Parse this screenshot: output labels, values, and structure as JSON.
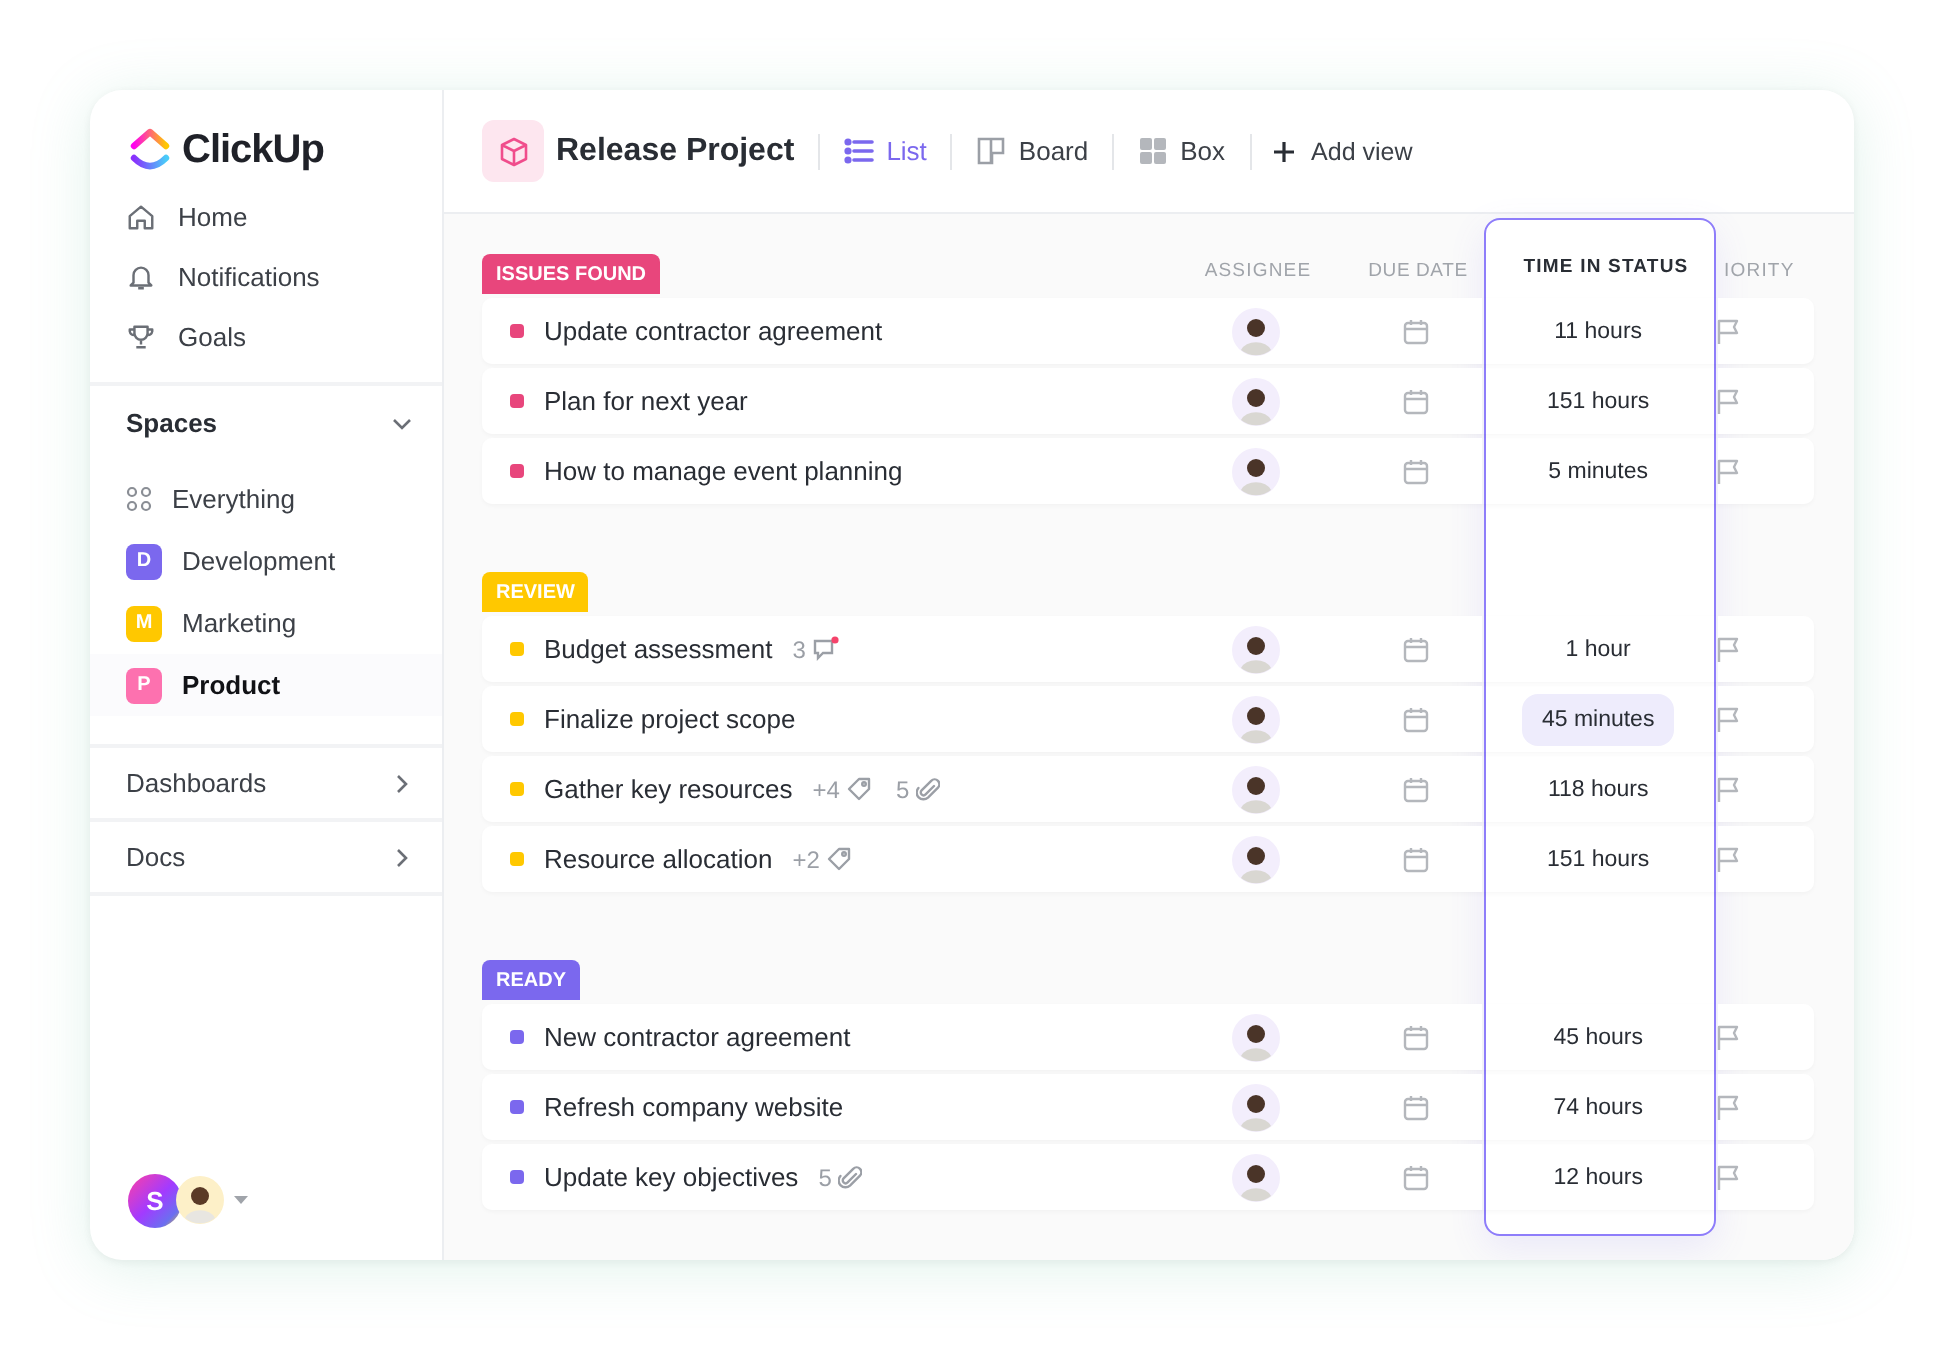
{
  "logo": {
    "text": "ClickUp"
  },
  "nav": [
    {
      "label": "Home"
    },
    {
      "label": "Notifications"
    },
    {
      "label": "Goals"
    }
  ],
  "spaces": {
    "title": "Spaces",
    "expanded": true,
    "items": [
      {
        "kind": "all",
        "label": "Everything",
        "selected": false
      },
      {
        "kind": "space",
        "initial": "D",
        "label": "Development",
        "color": "#7b68ee",
        "selected": false
      },
      {
        "kind": "space",
        "initial": "M",
        "label": "Marketing",
        "color": "#ffc800",
        "selected": false
      },
      {
        "kind": "space",
        "initial": "P",
        "label": "Product",
        "color": "#fd71af",
        "selected": true
      }
    ]
  },
  "sections": [
    {
      "label": "Dashboards"
    },
    {
      "label": "Docs"
    }
  ],
  "user": {
    "initial": "S"
  },
  "project": {
    "title": "Release Project"
  },
  "views": [
    {
      "label": "List",
      "selected": true
    },
    {
      "label": "Board",
      "selected": false
    },
    {
      "label": "Box",
      "selected": false
    }
  ],
  "add_view": "Add view",
  "columns": {
    "assignee": "ASSIGNEE",
    "due_date": "DUE DATE",
    "time_in_status": "TIME IN STATUS",
    "priority": "IORITY"
  },
  "groups": [
    {
      "status": "ISSUES FOUND",
      "color": "#e8467c",
      "tasks": [
        {
          "title": "Update contractor agreement",
          "time_in_status": "11 hours",
          "highlighted": false
        },
        {
          "title": "Plan for next year",
          "time_in_status": "151 hours",
          "highlighted": false
        },
        {
          "title": "How to manage event planning",
          "time_in_status": "5 minutes",
          "highlighted": false
        }
      ]
    },
    {
      "status": "REVIEW",
      "color": "#ffc800",
      "tasks": [
        {
          "title": "Budget assessment",
          "extras": [
            {
              "kind": "comments",
              "count": "3"
            }
          ],
          "time_in_status": "1 hour",
          "highlighted": false
        },
        {
          "title": "Finalize project scope",
          "time_in_status": "45 minutes",
          "highlighted": true
        },
        {
          "title": "Gather key resources",
          "extras": [
            {
              "kind": "tags",
              "count": "+4"
            },
            {
              "kind": "attachments",
              "count": "5"
            }
          ],
          "time_in_status": "118 hours",
          "highlighted": false
        },
        {
          "title": "Resource allocation",
          "extras": [
            {
              "kind": "tags",
              "count": "+2"
            }
          ],
          "time_in_status": "151 hours",
          "highlighted": false
        }
      ]
    },
    {
      "status": "READY",
      "color": "#7b68ee",
      "tasks": [
        {
          "title": "New contractor agreement",
          "time_in_status": "45 hours",
          "highlighted": false
        },
        {
          "title": "Refresh company website",
          "time_in_status": "74 hours",
          "highlighted": false
        },
        {
          "title": "Update key objectives",
          "extras": [
            {
              "kind": "attachments",
              "count": "5"
            }
          ],
          "time_in_status": "12 hours",
          "highlighted": false
        }
      ]
    }
  ]
}
